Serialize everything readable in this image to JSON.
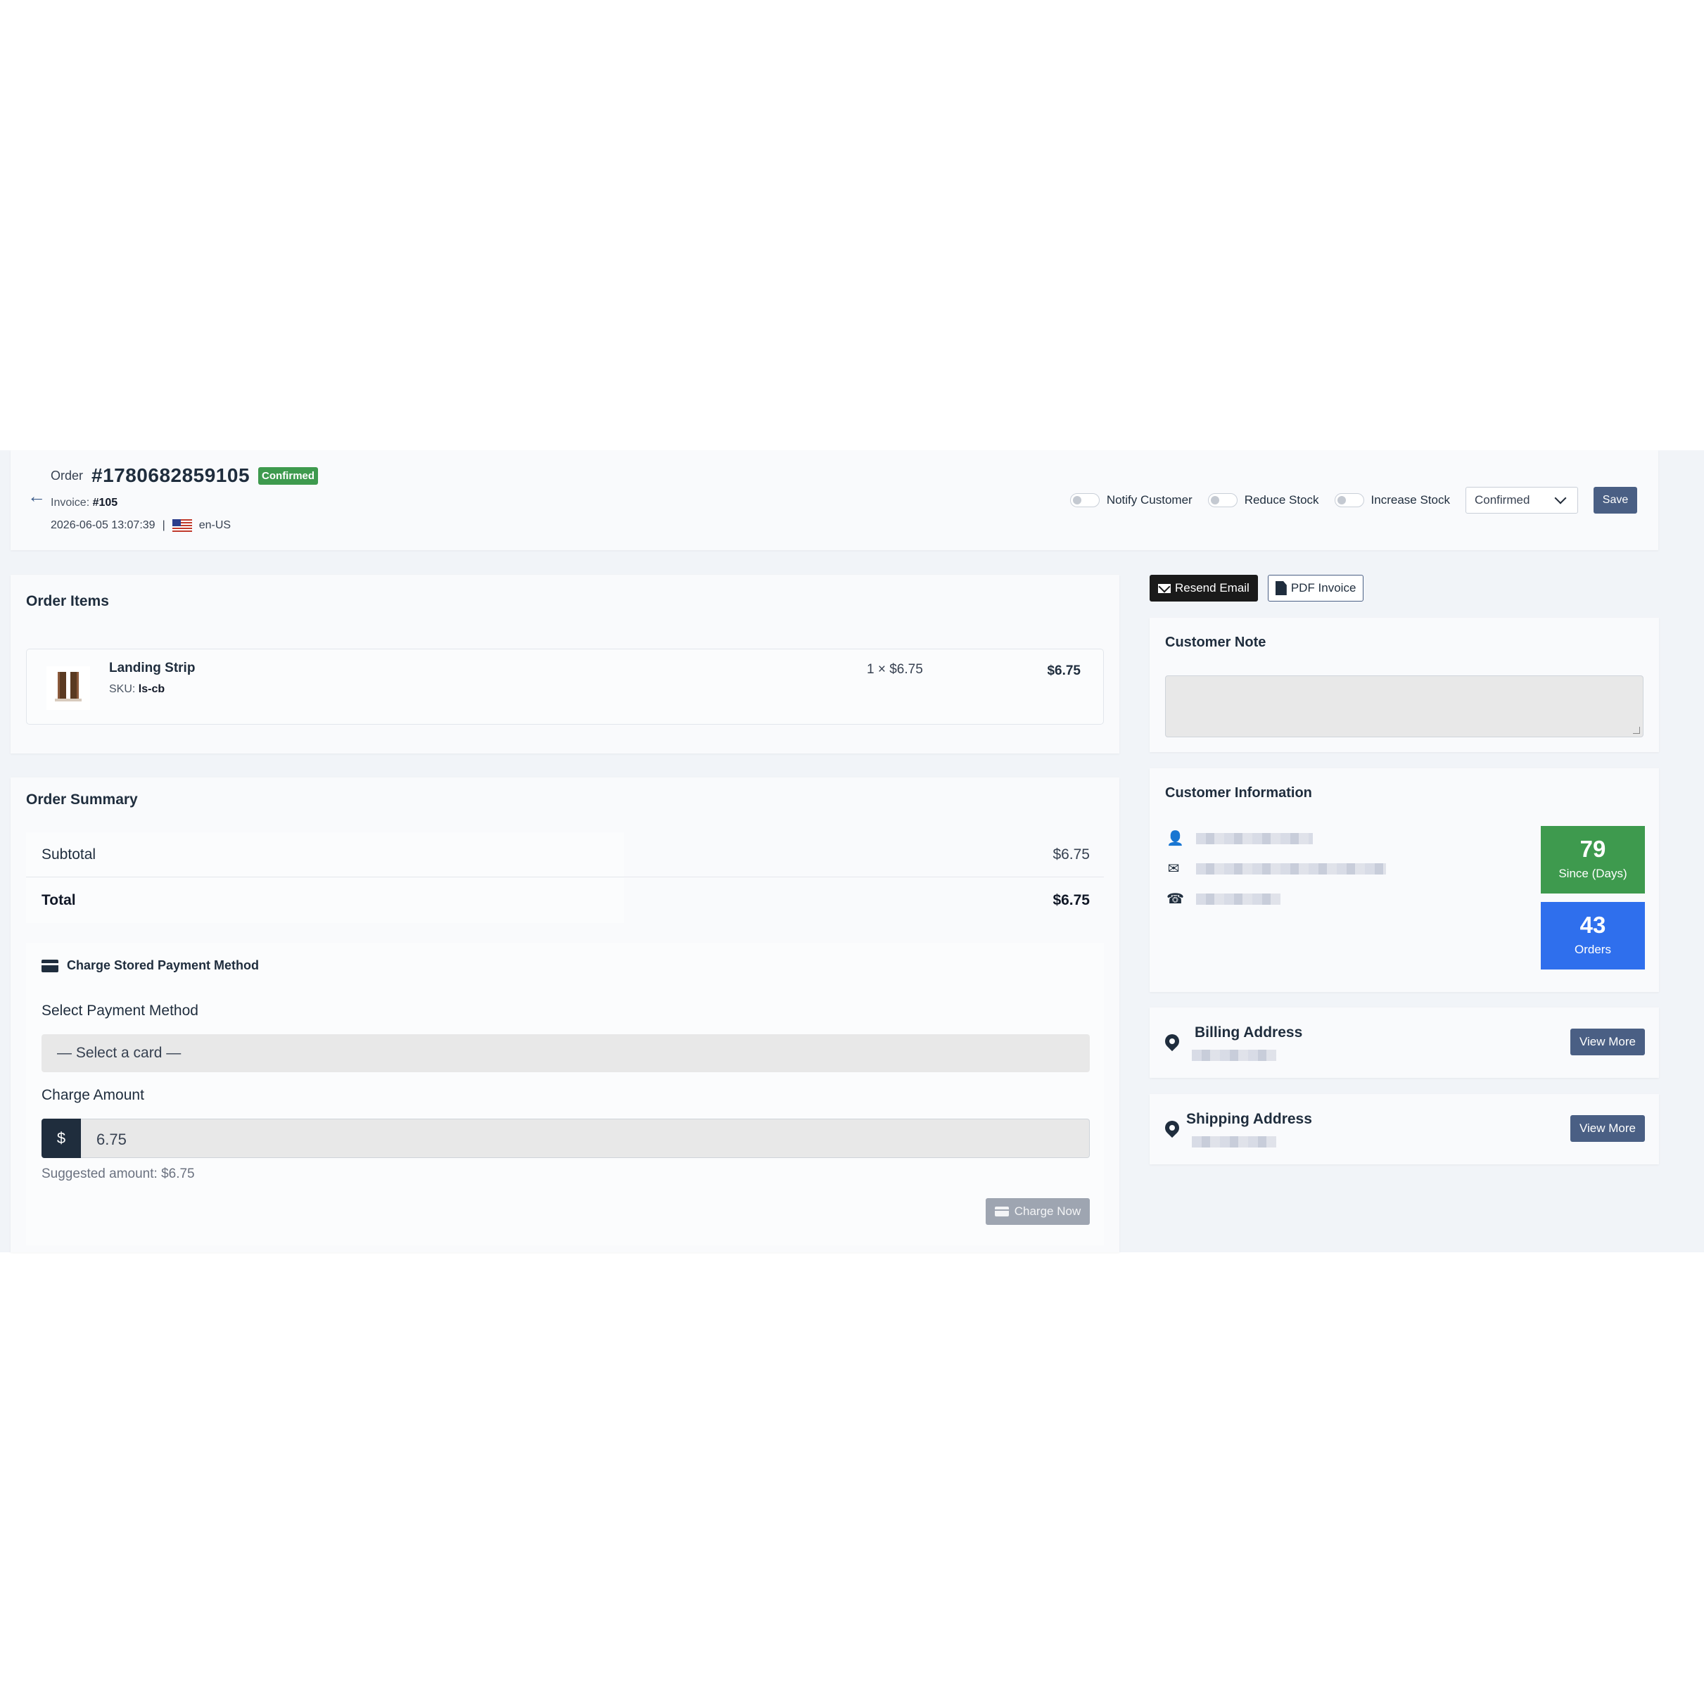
{
  "header": {
    "order_label": "Order",
    "order_number": "#1780682859105",
    "status_badge": "Confirmed",
    "invoice_label": "Invoice:",
    "invoice_number": "#105",
    "datetime": "2026-06-05 13:07:39",
    "separator": "|",
    "locale": "en-US",
    "toggles": {
      "notify_customer": "Notify Customer",
      "reduce_stock": "Reduce Stock",
      "increase_stock": "Increase Stock"
    },
    "status_select_value": "Confirmed",
    "save_label": "Save"
  },
  "order_items": {
    "title": "Order Items",
    "items": [
      {
        "name": "Landing Strip",
        "sku_label": "SKU:",
        "sku": "ls-cb",
        "qty_price": "1 × $6.75",
        "line_total": "$6.75"
      }
    ]
  },
  "order_summary": {
    "title": "Order Summary",
    "subtotal_label": "Subtotal",
    "subtotal_value": "$6.75",
    "total_label": "Total",
    "total_value": "$6.75",
    "charge": {
      "title": "Charge Stored Payment Method",
      "payment_method_label": "Select Payment Method",
      "payment_method_value": "— Select a card —",
      "amount_label": "Charge Amount",
      "currency_symbol": "$",
      "amount_value": "6.75",
      "suggested": "Suggested amount: $6.75",
      "charge_button": "Charge Now"
    }
  },
  "actions": {
    "resend_email": "Resend Email",
    "pdf_invoice": "PDF Invoice"
  },
  "customer_note": {
    "title": "Customer Note",
    "value": ""
  },
  "customer_info": {
    "title": "Customer Information",
    "since_value": "79",
    "since_label": "Since (Days)",
    "orders_value": "43",
    "orders_label": "Orders"
  },
  "billing_address": {
    "title": "Billing Address",
    "view_more": "View More"
  },
  "shipping_address": {
    "title": "Shipping Address",
    "view_more": "View More"
  },
  "colors": {
    "primary": "#4a5f84",
    "success": "#3e9a4e",
    "info": "#2f6fed",
    "dark": "#1f2d3d"
  }
}
